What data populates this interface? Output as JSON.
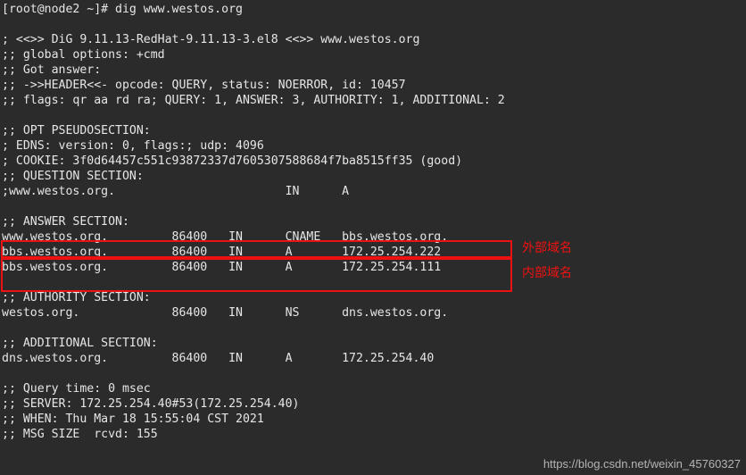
{
  "prompt": "[root@node2 ~]# dig www.westos.org",
  "blank1": " ",
  "dig_header": "; <<>> DiG 9.11.13-RedHat-9.11.13-3.el8 <<>> www.westos.org",
  "global_opts": ";; global options: +cmd",
  "got_answer": ";; Got answer:",
  "header_line": ";; ->>HEADER<<- opcode: QUERY, status: NOERROR, id: 10457",
  "flags_line": ";; flags: qr aa rd ra; QUERY: 1, ANSWER: 3, AUTHORITY: 1, ADDITIONAL: 2",
  "blank2": " ",
  "opt_title": ";; OPT PSEUDOSECTION:",
  "edns_line": "; EDNS: version: 0, flags:; udp: 4096",
  "cookie_line": "; COOKIE: 3f0d64457c551c93872337d7605307588684f7ba8515ff35 (good)",
  "question_title": ";; QUESTION SECTION:",
  "question_row": ";www.westos.org.                        IN      A",
  "blank3": " ",
  "answer_title": ";; ANSWER SECTION:",
  "ans_row1": "www.westos.org.         86400   IN      CNAME   bbs.westos.org.",
  "ans_row2": "bbs.westos.org.         86400   IN      A       172.25.254.222",
  "ans_row3": "bbs.westos.org.         86400   IN      A       172.25.254.111",
  "blank4": " ",
  "auth_title": ";; AUTHORITY SECTION:",
  "auth_row": "westos.org.             86400   IN      NS      dns.westos.org.",
  "blank5": " ",
  "add_title": ";; ADDITIONAL SECTION:",
  "add_row": "dns.westos.org.         86400   IN      A       172.25.254.40",
  "blank6": " ",
  "query_time": ";; Query time: 0 msec",
  "server_line": ";; SERVER: 172.25.254.40#53(172.25.254.40)",
  "when_line": ";; WHEN: Thu Mar 18 15:55:04 CST 2021",
  "msg_size": ";; MSG SIZE  rcvd: 155",
  "annotation_outer": "外部域名",
  "annotation_inner": "内部域名",
  "watermark": "https://blog.csdn.net/weixin_45760327",
  "chart_data": {
    "type": "table",
    "title": "dig www.westos.org output sections",
    "sections": {
      "question": [
        {
          "name": "www.westos.org.",
          "class": "IN",
          "type": "A"
        }
      ],
      "answer": [
        {
          "name": "www.westos.org.",
          "ttl": 86400,
          "class": "IN",
          "type": "CNAME",
          "data": "bbs.westos.org."
        },
        {
          "name": "bbs.westos.org.",
          "ttl": 86400,
          "class": "IN",
          "type": "A",
          "data": "172.25.254.222"
        },
        {
          "name": "bbs.westos.org.",
          "ttl": 86400,
          "class": "IN",
          "type": "A",
          "data": "172.25.254.111"
        }
      ],
      "authority": [
        {
          "name": "westos.org.",
          "ttl": 86400,
          "class": "IN",
          "type": "NS",
          "data": "dns.westos.org."
        }
      ],
      "additional": [
        {
          "name": "dns.westos.org.",
          "ttl": 86400,
          "class": "IN",
          "type": "A",
          "data": "172.25.254.40"
        }
      ]
    },
    "stats": {
      "query_time_msec": 0,
      "server": "172.25.254.40#53(172.25.254.40)",
      "when": "Thu Mar 18 15:55:04 CST 2021",
      "msg_size_rcvd": 155
    }
  }
}
